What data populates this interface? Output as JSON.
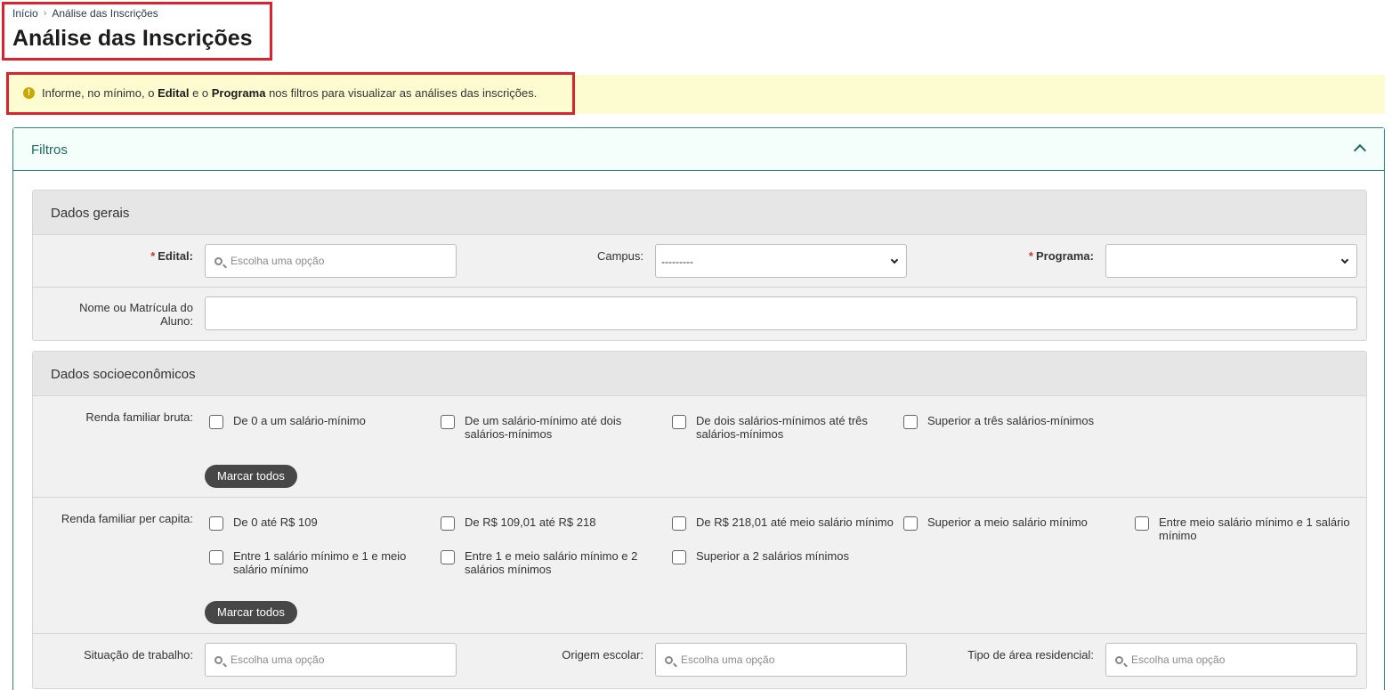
{
  "breadcrumb": {
    "home": "Início",
    "current": "Análise das Inscrições"
  },
  "page_title": "Análise das Inscrições",
  "alert": {
    "prefix": "Informe, no mínimo, o ",
    "edital": "Edital",
    "mid": " e o ",
    "programa": "Programa",
    "suffix": " nos filtros para visualizar as análises das inscrições."
  },
  "filters": {
    "title": "Filtros",
    "dados_gerais": {
      "title": "Dados gerais",
      "edital_label": "Edital:",
      "edital_placeholder": "Escolha uma opção",
      "campus_label": "Campus:",
      "campus_value": "---------",
      "programa_label": "Programa:",
      "programa_value": "",
      "nome_label": "Nome ou Matrícula do Aluno:",
      "nome_value": ""
    },
    "dados_socio": {
      "title": "Dados socioeconômicos",
      "renda_bruta_label": "Renda familiar bruta:",
      "renda_bruta_options": [
        "De 0 a um salário-mínimo",
        "De um salário-mínimo até dois salários-mínimos",
        "De dois salários-mínimos até três salários-mínimos",
        "Superior a três salários-mínimos"
      ],
      "mark_all": "Marcar todos",
      "renda_pc_label": "Renda familiar per capita:",
      "renda_pc_options": [
        "De 0 até R$ 109",
        "De R$ 109,01 até R$ 218",
        "De R$ 218,01 até meio salário mínimo",
        "Superior a meio salário mínimo",
        "Entre meio salário mínimo e 1 salário mínimo",
        "Entre 1 salário mínimo e 1 e meio salário mínimo",
        "Entre 1 e meio salário mínimo e 2 salários mínimos",
        "Superior a 2 salários mínimos"
      ],
      "mark_all_2": "Marcar todos",
      "situacao_label": "Situação de trabalho:",
      "situacao_placeholder": "Escolha uma opção",
      "origem_label": "Origem escolar:",
      "origem_placeholder": "Escolha uma opção",
      "area_label": "Tipo de área residencial:",
      "area_placeholder": "Escolha uma opção"
    }
  },
  "colors": {
    "accent": "#2d8a6e",
    "alert_bg": "#fdfbd0",
    "highlight_border": "#d9232d",
    "required": "#c0392b"
  },
  "icons": {
    "alert": "exclamation-circle-icon",
    "collapse": "chevron-up-icon",
    "search": "search-icon",
    "dropdown": "chevron-down-icon"
  }
}
